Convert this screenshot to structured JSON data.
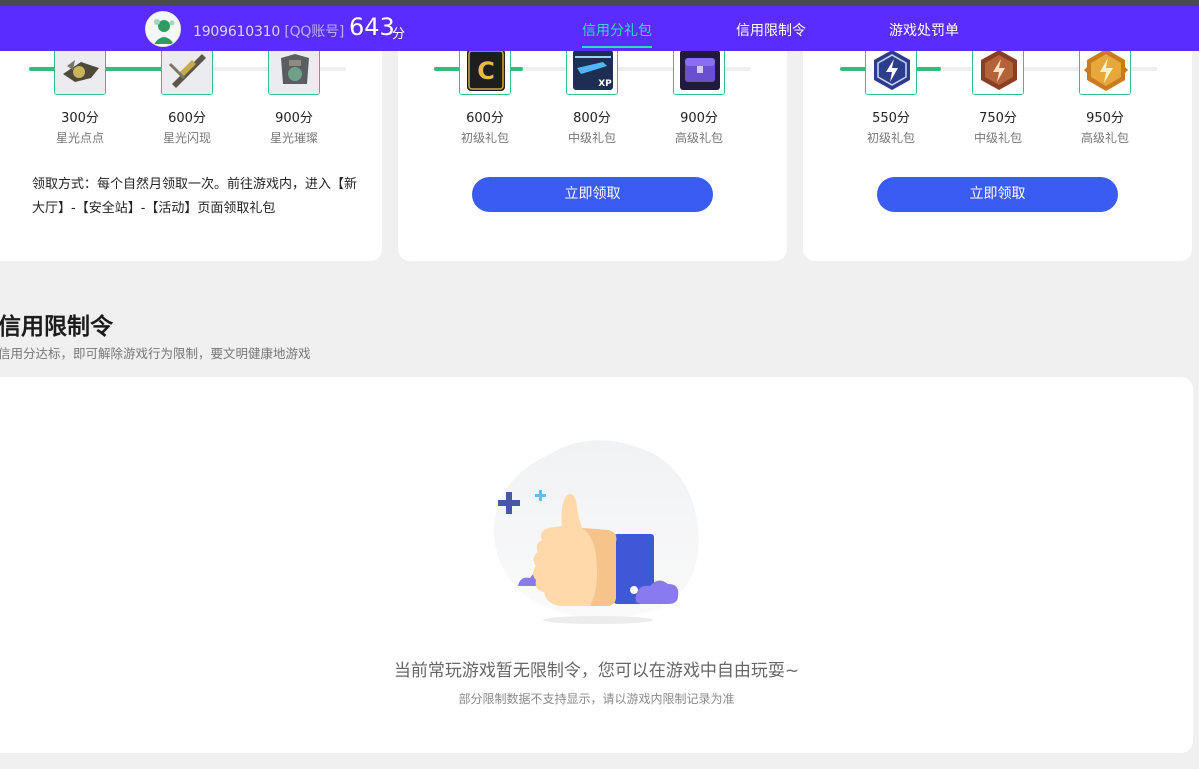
{
  "header": {
    "account_id": "1909610310",
    "account_type": "[QQ账号]",
    "score": "643",
    "score_unit": "分",
    "tabs": [
      {
        "label": "信用分礼包",
        "active": true
      },
      {
        "label": "信用限制令",
        "active": false
      },
      {
        "label": "游戏处罚单",
        "active": false
      }
    ]
  },
  "gift_cards": [
    {
      "progress": 0.58,
      "tiers": [
        {
          "points": "300分",
          "name": "星光点点",
          "icon": "starlight-weapon-icon"
        },
        {
          "points": "600分",
          "name": "星光闪现",
          "icon": "starlight-rifle-icon"
        },
        {
          "points": "900分",
          "name": "星光璀璨",
          "icon": "starlight-gear-icon"
        }
      ],
      "claim_method": "领取方式：每个自然月领取一次。前往游戏内，进入【新大厅】-【安全站】-【活动】页面领取礼包"
    },
    {
      "progress": 0.28,
      "tiers": [
        {
          "points": "600分",
          "name": "初级礼包",
          "icon": "c-badge-icon"
        },
        {
          "points": "800分",
          "name": "中级礼包",
          "icon": "xp-card-icon"
        },
        {
          "points": "900分",
          "name": "高级礼包",
          "icon": "treasure-chest-icon"
        }
      ],
      "button_label": "立即领取"
    },
    {
      "progress": 0.32,
      "tiers": [
        {
          "points": "550分",
          "name": "初级礼包",
          "icon": "blue-emblem-icon"
        },
        {
          "points": "750分",
          "name": "中级礼包",
          "icon": "bronze-emblem-icon"
        },
        {
          "points": "950分",
          "name": "高级礼包",
          "icon": "gold-emblem-icon"
        }
      ],
      "button_label": "立即领取"
    }
  ],
  "restriction_section": {
    "title": "信用限制令",
    "subtitle": "信用分达标，即可解除游戏行为限制，要文明健康地游戏",
    "empty_message": "当前常玩游戏暂无限制令，您可以在游戏中自由玩耍~",
    "empty_note": "部分限制数据不支持显示，请以游戏内限制记录为准",
    "illustration": "thumbs-up-illustration"
  },
  "colors": {
    "nav_bg": "#5a2cff",
    "nav_active": "#34d9c6",
    "progress": "#2fbf7c",
    "button": "#3a5cf2"
  }
}
